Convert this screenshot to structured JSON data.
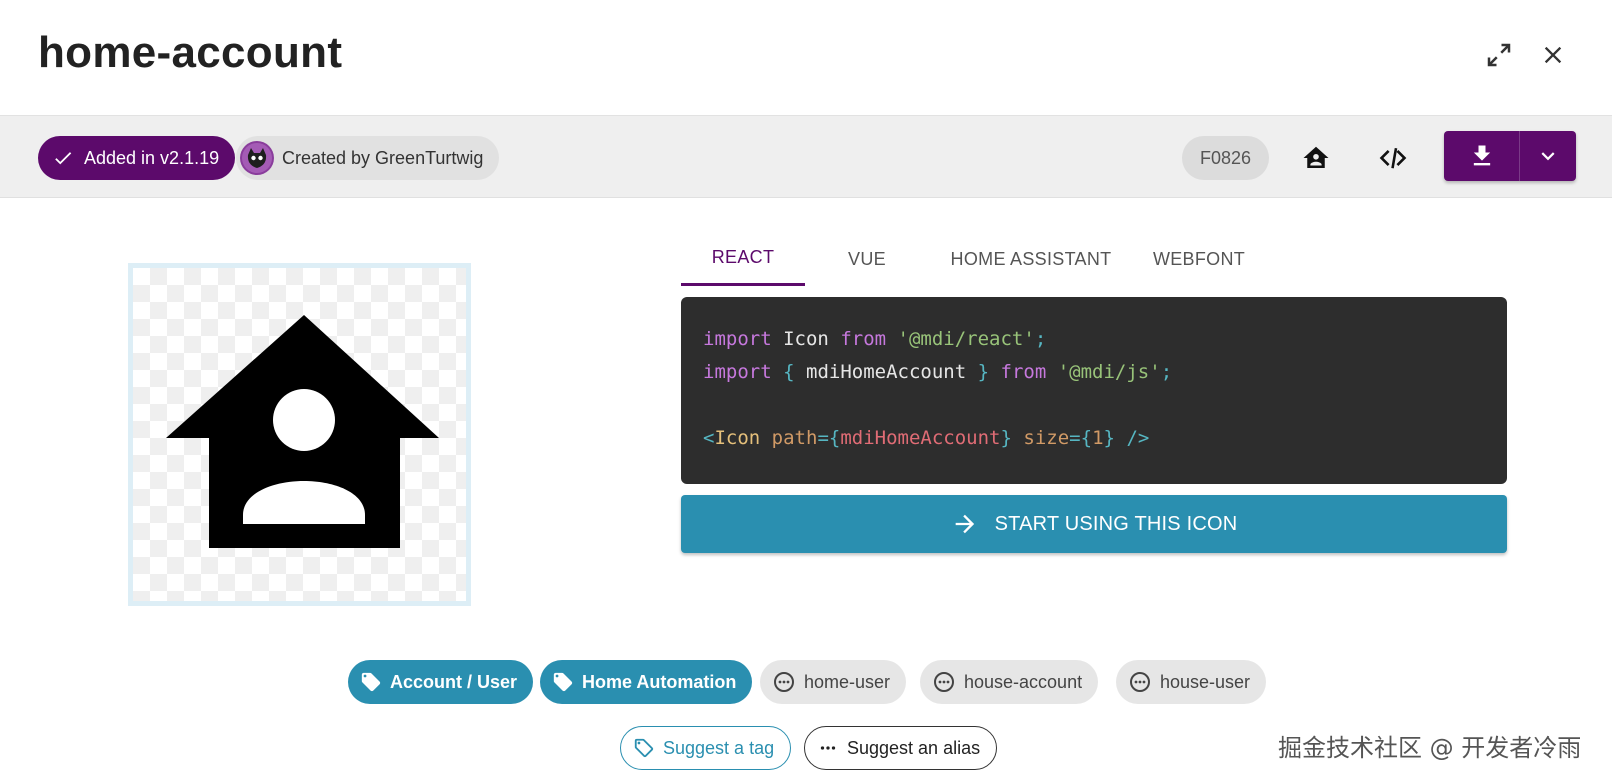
{
  "header": {
    "title": "home-account",
    "expand_icon": "expand-icon",
    "close_icon": "close-icon"
  },
  "meta": {
    "added_label": "Added in v2.1.19",
    "author_label": "Created by GreenTurtwig",
    "codepoint": "F0826",
    "accent_color": "#5c0a6b"
  },
  "preview": {
    "icon": "home-account-icon"
  },
  "tabs": [
    {
      "label": "REACT",
      "active": true
    },
    {
      "label": "VUE",
      "active": false
    },
    {
      "label": "HOME ASSISTANT",
      "active": false
    },
    {
      "label": "WEBFONT",
      "active": false
    }
  ],
  "code": {
    "import_kw": "import",
    "icon_ident": "Icon",
    "from_kw": "from",
    "react_pkg": "'@mdi/react'",
    "semi": ";",
    "brace_open": "{",
    "icon_name": "mdiHomeAccount",
    "brace_close": "}",
    "js_pkg": "'@mdi/js'",
    "jsx_open": "<",
    "jsx_tag": "Icon",
    "path_attr": "path",
    "eq": "=",
    "size_attr": "size",
    "size_val": "1",
    "jsx_close": "/>"
  },
  "start_button": {
    "label": "START USING THIS ICON",
    "color": "#2a8fb0"
  },
  "tags": [
    {
      "label": "Account / User",
      "kind": "tag"
    },
    {
      "label": "Home Automation",
      "kind": "tag"
    }
  ],
  "aliases": [
    {
      "label": "home-user"
    },
    {
      "label": "house-account"
    },
    {
      "label": "house-user"
    }
  ],
  "suggest": {
    "tag_label": "Suggest a tag",
    "alias_label": "Suggest an alias"
  },
  "watermark": "掘金技术社区 @ 开发者冷雨"
}
